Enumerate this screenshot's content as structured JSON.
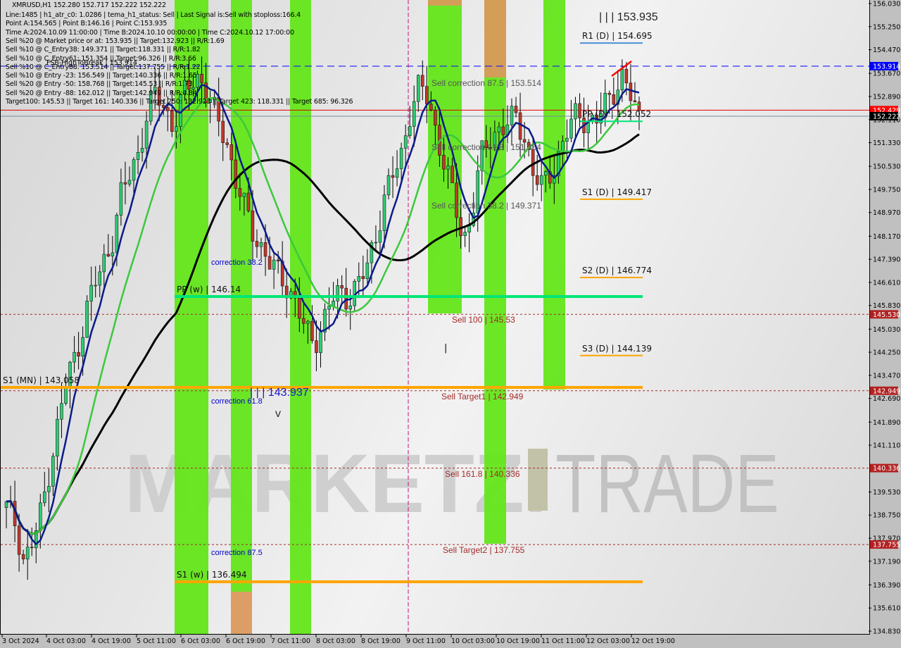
{
  "chart_data": {
    "type": "candlestick",
    "symbol": "XMRUSD",
    "timeframe": "H1",
    "ohlc_header": "XMRUSD,H1  152.280 152.717 152.222 152.222",
    "info_lines": [
      "Line:1485 | h1_atr_c0: 1.0286 | tema_h1_status: Sell | Last Signal is:Sell with stoploss:166.4",
      "Point A:154.565 | Point B:146.16 | Point C:153.935",
      "Time A:2024.10.09 11:00:00 | Time B:2024.10.10 00:00:00 | Time C:2024.10.12 17:00:00",
      "Sell %20 @ Market price or at: 153.935 || Target:132.923 || R/R:1.69",
      "Sell %10 @ C_Entry38: 149.371 || Target:118.331 || R/R:1.82",
      "Sell %10 @ C_Entry61: 151.354 || Target:96.326 || R/R:3.66",
      "Sell %10 @ C_Entry88: 153.514 || Target:137.755 || R/R:1.22",
      "Sell %10 @ Entry -23: 156.549 || Target:140.336 || R/R:1.65",
      "Sell %20 @ Entry -50: 158.768 || Target:145.53 || R/R:1.73",
      "Sell %20 @ Entry -88: 162.012 || Target:142.949 || R/R:4.84",
      "Target100: 145.53 || Target 161: 140.336 || Target 250: 132.923 || Target 423: 118.331 || Target 685: 96.326"
    ],
    "y_axis": {
      "range": [
        134.83,
        156.03
      ],
      "ticks": [
        "156.030",
        "155.250",
        "154.470",
        "153.670",
        "152.890",
        "152.110",
        "151.330",
        "150.530",
        "149.750",
        "148.970",
        "148.170",
        "147.390",
        "146.610",
        "145.830",
        "145.030",
        "144.250",
        "143.470",
        "142.690",
        "141.890",
        "141.110",
        "139.530",
        "138.750",
        "137.970",
        "137.190",
        "136.390",
        "135.610",
        "134.830"
      ]
    },
    "x_axis": {
      "ticks": [
        "3 Oct 2024",
        "4 Oct 03:00",
        "4 Oct 19:00",
        "5 Oct 11:00",
        "6 Oct 03:00",
        "6 Oct 19:00",
        "7 Oct 11:00",
        "8 Oct 03:00",
        "8 Oct 19:00",
        "9 Oct 11:00",
        "10 Oct 03:00",
        "10 Oct 19:00",
        "11 Oct 11:00",
        "12 Oct 03:00",
        "12 Oct 19:00"
      ]
    },
    "price_tags": [
      {
        "value": 153.914,
        "label": "153.914",
        "color": "#0000ff"
      },
      {
        "value": 152.429,
        "label": "152.429",
        "color": "#ff0000"
      },
      {
        "value": 152.222,
        "label": "152.222",
        "color": "#000000"
      },
      {
        "value": 145.53,
        "label": "145.530",
        "color": "#b22222"
      },
      {
        "value": 142.949,
        "label": "142.949",
        "color": "#b22222"
      },
      {
        "value": 140.336,
        "label": "140.336",
        "color": "#b22222"
      },
      {
        "value": 137.755,
        "label": "137.755",
        "color": "#b22222"
      }
    ],
    "pivot_levels": [
      {
        "label": "R1 (D) | 154.695",
        "value": 154.695,
        "color": "#4a90d9"
      },
      {
        "label": "PP (D) | 152.052",
        "value": 152.052,
        "color": "#00e676"
      },
      {
        "label": "S1 (D) | 149.417",
        "value": 149.417,
        "color": "#ffa500"
      },
      {
        "label": "S2 (D) | 146.774",
        "value": 146.774,
        "color": "#ffa500"
      },
      {
        "label": "S3 (D) | 144.139",
        "value": 144.139,
        "color": "#ffa500"
      },
      {
        "label": "PP (w) | 146.14",
        "value": 146.14,
        "color": "#00e676"
      },
      {
        "label": "S1 (w) | 136.494",
        "value": 136.494,
        "color": "#ffa500"
      },
      {
        "label": "S1 (MN) | 143.058",
        "value": 143.058,
        "color": "#ffa500"
      }
    ],
    "sell_levels": [
      {
        "label": "Sell 100 | 145.53",
        "value": 145.53
      },
      {
        "label": "Sell Target1 | 142.949",
        "value": 142.949
      },
      {
        "label": "Sell 161.8 | 140.336",
        "value": 140.336
      },
      {
        "label": "Sell Target2 | 137.755",
        "value": 137.755
      }
    ],
    "sell_corrections": [
      {
        "label": "Sell correction 87.5 | 153.514",
        "value": 153.514
      },
      {
        "label": "Sell correction 61.8 | 151.354",
        "value": 151.354
      },
      {
        "label": "Sell correction 38.2 | 149.371",
        "value": 149.371
      }
    ],
    "corrections": [
      {
        "label": "correction 38.2",
        "value": 147.53
      },
      {
        "label": "correction 61.8",
        "value": 142.65
      },
      {
        "label": "correction 87.5",
        "value": 137.6
      }
    ],
    "point_labels": [
      {
        "label": "| | | 153.935",
        "value": 155.6
      },
      {
        "label": "| | | 143.937",
        "value": 143.0
      }
    ],
    "fsb_label": "FSB-HighToBreak | 153.914",
    "watermark": {
      "left": "MARKETZI",
      "right": "TRADE"
    },
    "current_price": 152.222,
    "series": [
      {
        "name": "close_approx",
        "values": [
          139.0,
          138.5,
          137.2,
          137.8,
          138.9,
          140.5,
          142.0,
          143.5,
          144.2,
          145.6,
          146.5,
          147.2,
          148.0,
          149.5,
          150.2,
          151.0,
          152.3,
          153.0,
          152.5,
          151.9,
          152.8,
          153.4,
          153.6,
          152.8,
          152.1,
          151.5,
          150.1,
          149.2,
          148.4,
          147.8,
          147.2,
          146.9,
          146.5,
          145.8,
          145.0,
          144.6,
          145.2,
          146.0,
          146.3,
          146.1,
          146.5,
          147.1,
          148.2,
          149.4,
          150.2,
          151.0,
          152.5,
          153.2,
          152.8,
          151.6,
          150.4,
          149.3,
          148.0,
          149.0,
          150.8,
          151.5,
          151.8,
          151.9,
          152.2,
          151.5,
          150.2,
          149.8,
          150.4,
          151.0,
          151.8,
          152.4,
          152.1,
          151.9,
          152.6,
          153.1,
          153.5,
          152.9,
          152.222
        ]
      }
    ]
  },
  "ui": {
    "cursor_glyph": "|",
    "down_marker": "V"
  }
}
